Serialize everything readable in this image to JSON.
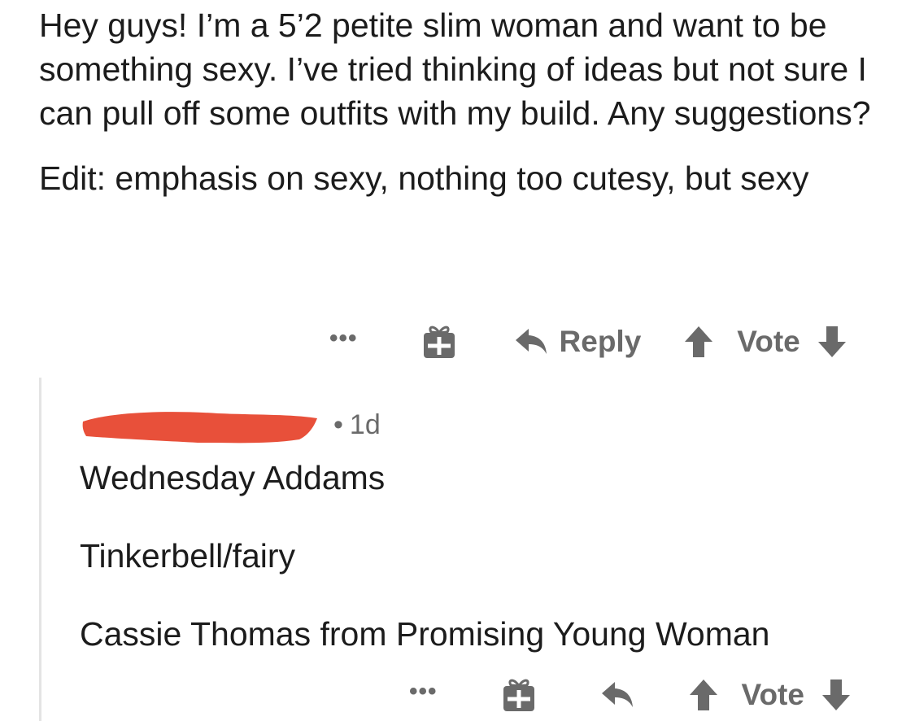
{
  "post": {
    "paragraphs": [
      "Hey guys! I’m a 5’2 petite slim woman and want to be something sexy. I’ve tried thinking of ideas but not sure I can pull off some outfits with my build. Any suggestions?",
      "Edit: emphasis on sexy, nothing too cutesy, but sexy"
    ],
    "actions": {
      "more": "•••",
      "reply_label": "Reply",
      "vote_label": "Vote"
    }
  },
  "comment": {
    "username_redacted": true,
    "redaction_color": "#e8503a",
    "separator": "•",
    "age": "1d",
    "lines": [
      "Wednesday Addams",
      "Tinkerbell/fairy",
      "Cassie Thomas from Promising Young Woman"
    ],
    "actions": {
      "more": "•••",
      "vote_label": "Vote"
    }
  },
  "colors": {
    "text": "#1c1c1c",
    "muted": "#6a6a6a",
    "thread_line": "#e4e4e4"
  },
  "icons": [
    "more-icon",
    "gift-icon",
    "reply-icon",
    "upvote-icon",
    "downvote-icon"
  ]
}
